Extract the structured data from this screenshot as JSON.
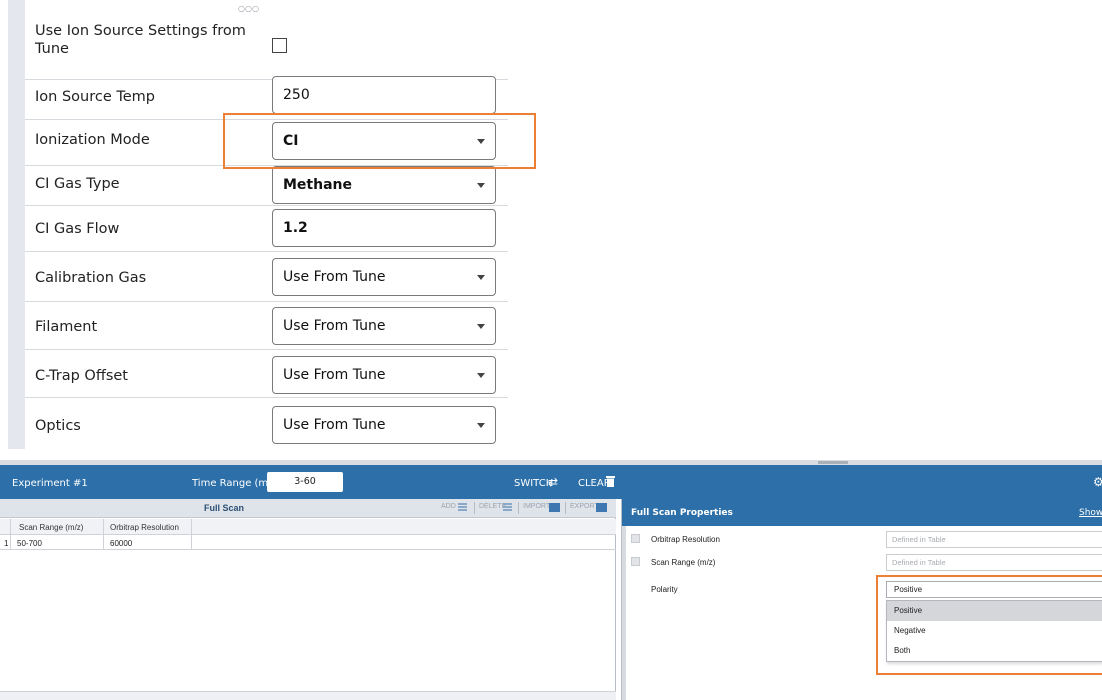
{
  "settings": {
    "rows": [
      {
        "label": "Use Ion Source Settings from Tune",
        "type": "checkbox"
      },
      {
        "label": "Ion Source Temp",
        "value": "250"
      },
      {
        "label": "Ionization Mode",
        "value": "CI"
      },
      {
        "label": "CI Gas Type",
        "value": "Methane"
      },
      {
        "label": "CI Gas Flow",
        "value": "1.2"
      },
      {
        "label": "Calibration Gas",
        "value": "Use From Tune"
      },
      {
        "label": "Filament",
        "value": "Use From Tune"
      },
      {
        "label": "C-Trap Offset",
        "value": "Use From Tune"
      },
      {
        "label": "Optics",
        "value": "Use From Tune"
      }
    ],
    "highlight_color": "#ec7f33"
  },
  "experiment": {
    "title": "Experiment #1",
    "time_range_label": "Time Range (min)",
    "time_range_value": "3-60",
    "switch_label": "SWITCH",
    "clear_label": "CLEAR",
    "accent_color": "#2d6fa8"
  },
  "full_scan": {
    "title": "Full Scan",
    "toolbar": {
      "add": "ADD",
      "delete": "DELETE",
      "import": "IMPORT",
      "export": "EXPORT"
    },
    "columns": [
      "Scan Range (m/z)",
      "Orbitrap Resolution"
    ],
    "rows": [
      {
        "index": "1",
        "scan_range": "50-700",
        "resolution": "60000"
      }
    ]
  },
  "properties": {
    "title": "Full Scan Properties",
    "show_link": "Show",
    "rows": [
      {
        "label": "Orbitrap Resolution",
        "value": "Defined in Table"
      },
      {
        "label": "Scan Range (m/z)",
        "value": "Defined in Table"
      },
      {
        "label": "Polarity",
        "value": "Positive"
      }
    ],
    "polarity_options": [
      "Positive",
      "Negative",
      "Both"
    ],
    "selected_option": "Positive"
  }
}
